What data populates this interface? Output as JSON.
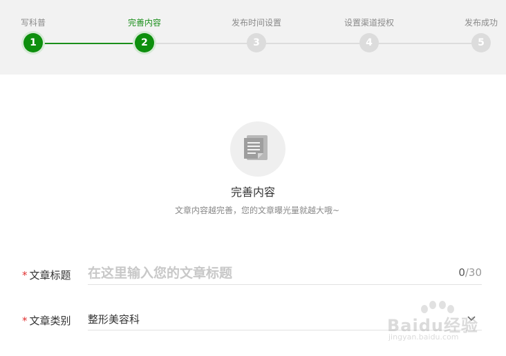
{
  "steps": [
    {
      "label": "写科普",
      "number": "1",
      "status": "done"
    },
    {
      "label": "完善内容",
      "number": "2",
      "status": "current"
    },
    {
      "label": "发布时间设置",
      "number": "3",
      "status": "todo"
    },
    {
      "label": "设置渠道授权",
      "number": "4",
      "status": "todo"
    },
    {
      "label": "发布成功",
      "number": "5",
      "status": "todo"
    }
  ],
  "colors": {
    "accent": "#0d8f0d",
    "inactive": "#dcdcdc",
    "required": "#e03030"
  },
  "hero": {
    "icon": "document-icon",
    "title": "完善内容",
    "subtitle": "文章内容越完善，您的文章曝光量就越大哦~"
  },
  "form": {
    "title_field": {
      "required_mark": "*",
      "label": "文章标题",
      "value": "",
      "placeholder": "在这里输入您的文章标题",
      "count": "0",
      "max": "/30"
    },
    "category_field": {
      "required_mark": "*",
      "label": "文章类别",
      "value": "整形美容科",
      "icon": "chevron-down-icon"
    }
  },
  "watermark": {
    "text": "Baidu经验",
    "url_text": "jingyan.baidu.com"
  }
}
